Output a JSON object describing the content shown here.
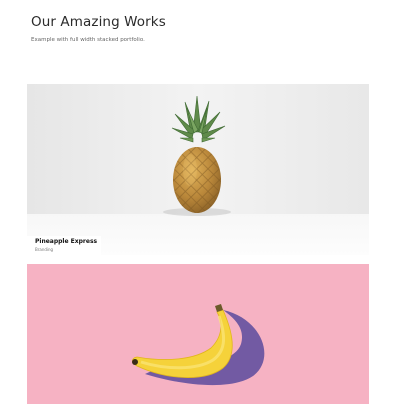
{
  "header": {
    "title": "Our Amazing Works",
    "subtitle": "Example with full width stacked portfolio."
  },
  "portfolio": {
    "items": [
      {
        "title": "Pineapple Express",
        "category": "Branding",
        "image": "pineapple-photo",
        "background_color": "#eeeeee"
      },
      {
        "title": "",
        "category": "",
        "image": "banana-photo",
        "background_color": "#f6b2c3"
      }
    ]
  }
}
